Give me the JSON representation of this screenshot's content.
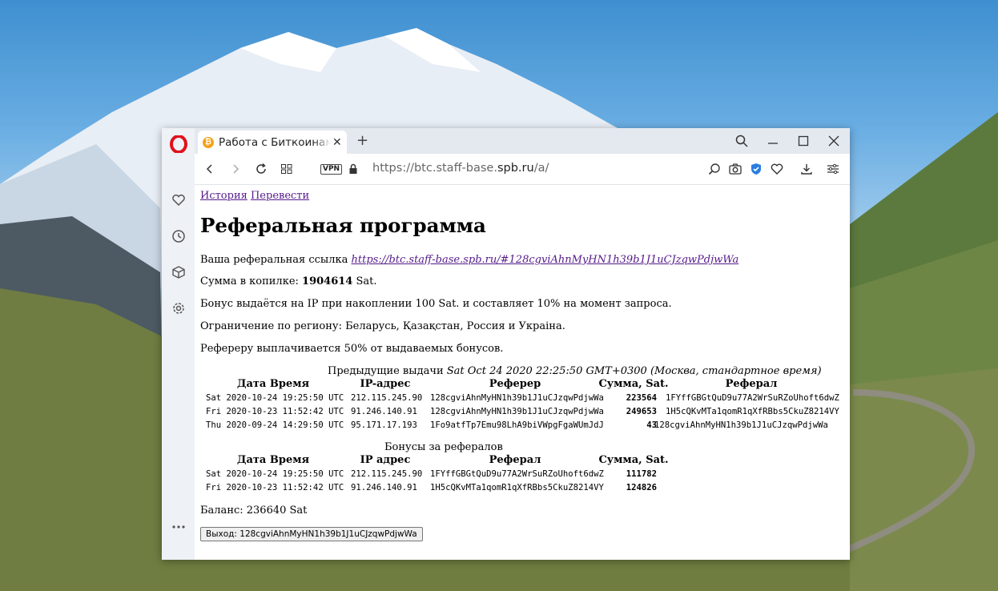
{
  "browser": {
    "tab_title": "Работа с Биткоинами",
    "tab_favicon": "₿",
    "url_prefix": "https://btc.staff-base.",
    "url_host": "spb.ru",
    "url_path": "/a/",
    "vpn_label": "VPN",
    "icons": [
      "opera-logo-icon",
      "heart-icon",
      "history-icon",
      "cube-icon",
      "settings-icon",
      "more-icon",
      "search-icon",
      "minimize-icon",
      "maximize-icon",
      "close-icon",
      "back-icon",
      "forward-icon",
      "reload-icon",
      "tabs-grid-icon",
      "lock-icon",
      "zoom-icon",
      "camera-icon",
      "shield-icon",
      "bookmark-heart-icon",
      "download-icon",
      "easy-setup-icon"
    ]
  },
  "page": {
    "nav": {
      "history": "История",
      "translate": "Перевести"
    },
    "title": "Реферальная программа",
    "ref_label": "Ваша реферальная ссылка",
    "ref_link": "https://btc.staff-base.spb.ru/#128cgviAhnMyHN1h39b1J1uCJzqwPdjwWa",
    "piggy_label": "Сумма в копилке:",
    "piggy_amount": "1904614",
    "piggy_unit": "Sat.",
    "bonus_text": "Бонус выдаётся на IP при накоплении 100 Sat. и составляет 10% на момент запроса.",
    "region_text": "Ограничение по региону: Беларусь, Қазақстан, Россия и Украіна.",
    "referrer_text": "Рефереру выплачивается 50% от выдаваемых бонусов.",
    "payouts": {
      "caption": "Предыдущие выдачи",
      "caption_date": "Sat Oct 24 2020 22:25:50 GMT+0300 (Москва, стандартное время)",
      "headers": [
        "Дата Время",
        "IP-адрес",
        "Реферер",
        "Сумма, Sat.",
        "Реферал"
      ],
      "rows": [
        [
          "Sat 2020-10-24 19:25:50 UTC",
          "212.115.245.90",
          "128cgviAhnMyHN1h39b1J1uCJzqwPdjwWa",
          "223564",
          "1FYffGBGtQuD9u77A2WrSuRZoUhoft6dwZ"
        ],
        [
          "Fri 2020-10-23 11:52:42 UTC",
          "91.246.140.91",
          "128cgviAhnMyHN1h39b1J1uCJzqwPdjwWa",
          "249653",
          "1H5cQKvMTa1qomR1qXfRBbs5CkuZ8214VY"
        ],
        [
          "Thu 2020-09-24 14:29:50 UTC",
          "95.171.17.193",
          "1Fo9atfTp7Emu98LhA9biVWpgFgaWUmJdJ",
          "43",
          "128cgviAhnMyHN1h39b1J1uCJzqwPdjwWa"
        ]
      ]
    },
    "bonuses": {
      "caption": "Бонусы за рефералов",
      "headers": [
        "Дата Время",
        "IP адрес",
        "Реферал",
        "Сумма, Sat."
      ],
      "rows": [
        [
          "Sat 2020-10-24 19:25:50 UTC",
          "212.115.245.90",
          "1FYffGBGtQuD9u77A2WrSuRZoUhoft6dwZ",
          "111782"
        ],
        [
          "Fri 2020-10-23 11:52:42 UTC",
          "91.246.140.91",
          "1H5cQKvMTa1qomR1qXfRBbs5CkuZ8214VY",
          "124826"
        ]
      ]
    },
    "balance": "Баланс: 236640 Sat",
    "logout_button": "Выход: 128cgviAhnMyHN1h39b1J1uCJzqwPdjwWa"
  },
  "colors": {
    "link": "#551a8b",
    "opera_red": "#e0111b",
    "shield_blue": "#2a7de1",
    "favicon": "#f3a21a"
  }
}
